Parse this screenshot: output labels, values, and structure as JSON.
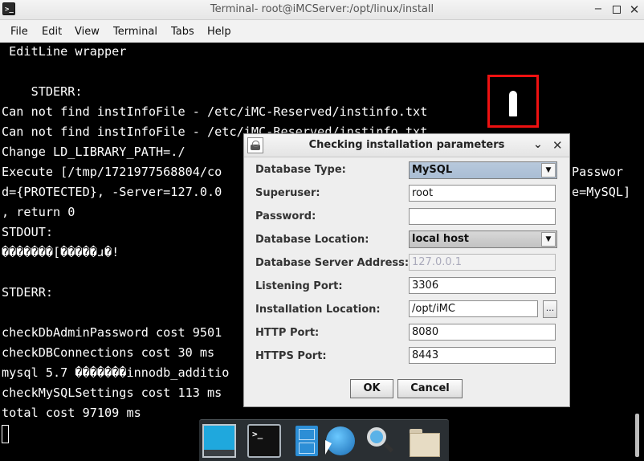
{
  "window": {
    "title": "Terminal- root@iMCServer:/opt/linux/install",
    "app_icon": ">_",
    "controls": {
      "minimize": "−",
      "close": "✕"
    }
  },
  "menubar": [
    "File",
    "Edit",
    "View",
    "Terminal",
    "Tabs",
    "Help"
  ],
  "terminal": {
    "lines": [
      " EditLine wrapper",
      "",
      "    STDERR:",
      "Can not find instInfoFile - /etc/iMC-Reserved/instinfo.txt",
      "Can not find instInfoFile - /etc/iMC-Reserved/instinfo.txt",
      "Change LD_LIBRARY_PATH=./",
      "Execute [/tmp/1721977568804/co",
      "d={PROTECTED}, -Server=127.0.0",
      ", return 0",
      "STDOUT:",
      "�������[�����ɹ�!",
      "",
      "STDERR:",
      "",
      "checkDbAdminPassword cost 9501",
      "checkDBConnections cost 30 ms",
      "mysql 5.7 �������innodb_additio",
      "checkMySQLSettings cost 113 ms",
      "total cost 97109 ms"
    ],
    "right_fragments": [
      "Passwor",
      "e=MySQL]"
    ]
  },
  "dialog": {
    "title": "Checking installation parameters",
    "controls": {
      "minimize": "⌄",
      "close": "✕"
    },
    "fields": {
      "database_type": {
        "label": "Database Type:",
        "value": "MySQL"
      },
      "superuser": {
        "label": "Superuser:",
        "value": "root"
      },
      "password": {
        "label": "Password:",
        "value": ""
      },
      "database_location": {
        "label": "Database Location:",
        "value": "local host"
      },
      "database_server_address": {
        "label": "Database Server Address:",
        "value": "127.0.0.1"
      },
      "listening_port": {
        "label": "Listening Port:",
        "value": "3306"
      },
      "installation_location": {
        "label": "Installation Location:",
        "value": "/opt/iMC",
        "browse": "..."
      },
      "http_port": {
        "label": "HTTP Port:",
        "value": "8080"
      },
      "https_port": {
        "label": "HTTPS Port:",
        "value": "8443"
      }
    },
    "buttons": {
      "ok": "OK",
      "cancel": "Cancel"
    }
  },
  "dock": {
    "items": [
      "desktop-icon",
      "terminal-icon",
      "file-cabinet-icon",
      "web-browser-icon",
      "search-icon",
      "folder-icon"
    ],
    "terminal_glyph": ">_"
  },
  "colors": {
    "terminal_bg": "#000000",
    "terminal_fg": "#ffffff",
    "highlight": "#ee1111",
    "combo_selected": "#b0c4da"
  }
}
